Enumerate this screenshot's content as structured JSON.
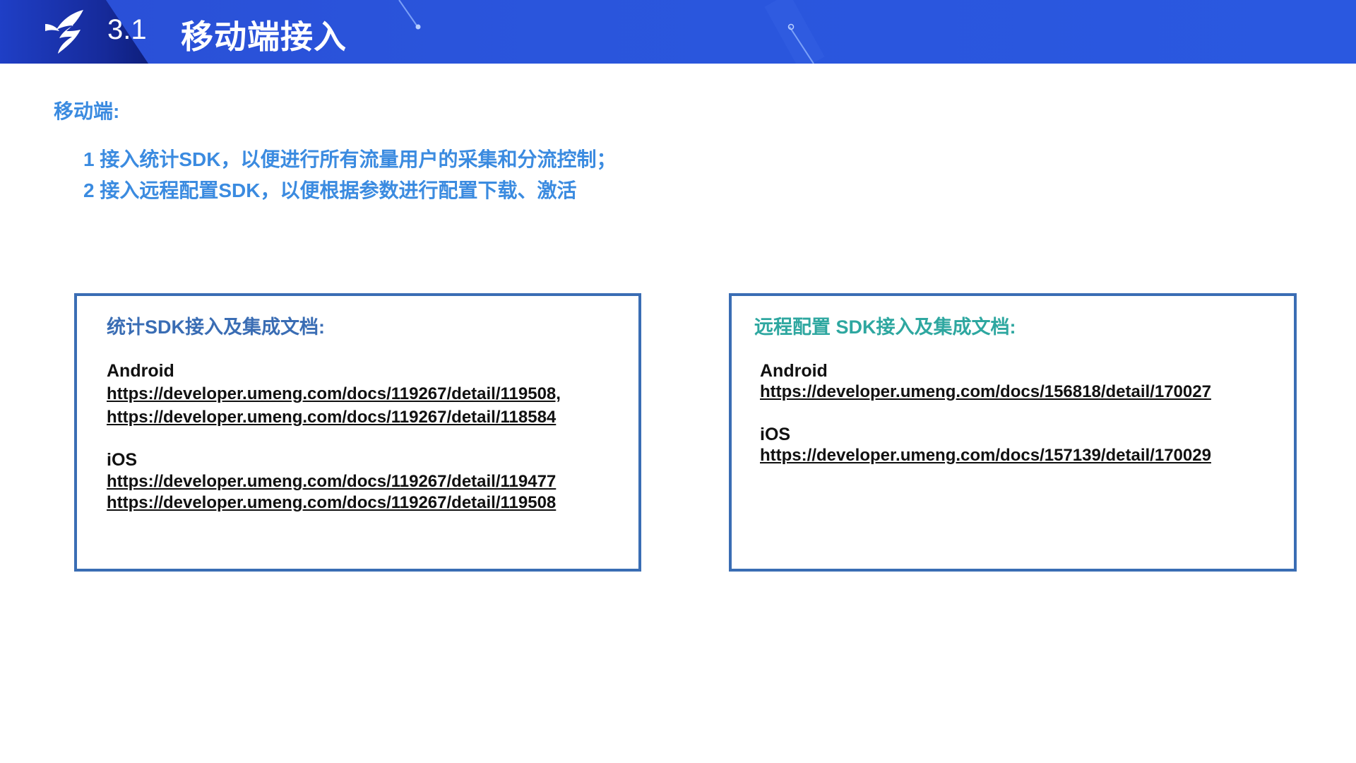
{
  "header": {
    "section_number": "3.1",
    "title": "移动端接入"
  },
  "content": {
    "subheading": "移动端:",
    "points": [
      "1 接入统计SDK，以便进行所有流量用户的采集和分流控制；",
      "2 接入远程配置SDK，以便根据参数进行配置下载、激活"
    ]
  },
  "cards": {
    "stats_sdk": {
      "title": "统计SDK接入及集成文档:",
      "android_label": "Android",
      "android_links": [
        "https://developer.umeng.com/docs/119267/detail/119508,",
        "https://developer.umeng.com/docs/119267/detail/118584"
      ],
      "ios_label": "iOS",
      "ios_links": [
        "https://developer.umeng.com/docs/119267/detail/119477",
        "https://developer.umeng.com/docs/119267/detail/119508"
      ]
    },
    "remote_config_sdk": {
      "title": "远程配置 SDK接入及集成文档:",
      "android_label": "Android",
      "android_link": "https://developer.umeng.com/docs/156818/detail/170027",
      "ios_label": "iOS",
      "ios_link": "https://developer.umeng.com/docs/157139/detail/170029"
    }
  },
  "colors": {
    "header_blue": "#2a55dc",
    "accent_blue": "#3b8be0",
    "card_border": "#3a6db4",
    "teal_title": "#2ea7a0"
  },
  "icons": {
    "logo": "bird-logo-icon"
  }
}
